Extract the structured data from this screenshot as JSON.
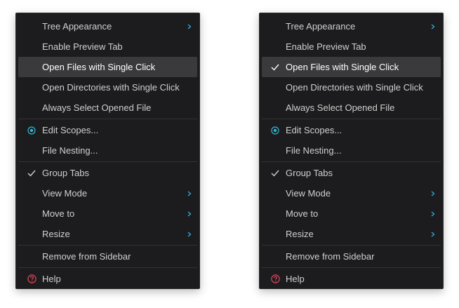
{
  "colors": {
    "menu_bg": "#1c1c1e",
    "highlight_bg": "#3a3a3c",
    "text": "#cfcfcf",
    "arrow": "#3aa6d6",
    "scope_icon": "#2fb8d8",
    "help_icon": "#e0455a"
  },
  "left_menu": {
    "items": [
      {
        "label": "Tree Appearance",
        "submenu": true
      },
      {
        "label": "Enable Preview Tab"
      },
      {
        "label": "Open Files with Single Click",
        "highlighted": true
      },
      {
        "label": "Open Directories with Single Click"
      },
      {
        "label": "Always Select Opened File"
      },
      {
        "label": "Edit Scopes...",
        "icon": "scope-icon"
      },
      {
        "label": "File Nesting..."
      },
      {
        "label": "Group Tabs",
        "checked": true
      },
      {
        "label": "View Mode",
        "submenu": true
      },
      {
        "label": "Move to",
        "submenu": true
      },
      {
        "label": "Resize",
        "submenu": true
      },
      {
        "label": "Remove from Sidebar"
      },
      {
        "label": "Help",
        "icon": "help-icon"
      }
    ]
  },
  "right_menu": {
    "items": [
      {
        "label": "Tree Appearance",
        "submenu": true
      },
      {
        "label": "Enable Preview Tab"
      },
      {
        "label": "Open Files with Single Click",
        "highlighted": true,
        "checked": true
      },
      {
        "label": "Open Directories with Single Click"
      },
      {
        "label": "Always Select Opened File"
      },
      {
        "label": "Edit Scopes...",
        "icon": "scope-icon"
      },
      {
        "label": "File Nesting..."
      },
      {
        "label": "Group Tabs",
        "checked": true
      },
      {
        "label": "View Mode",
        "submenu": true
      },
      {
        "label": "Move to",
        "submenu": true
      },
      {
        "label": "Resize",
        "submenu": true
      },
      {
        "label": "Remove from Sidebar"
      },
      {
        "label": "Help",
        "icon": "help-icon"
      }
    ]
  }
}
